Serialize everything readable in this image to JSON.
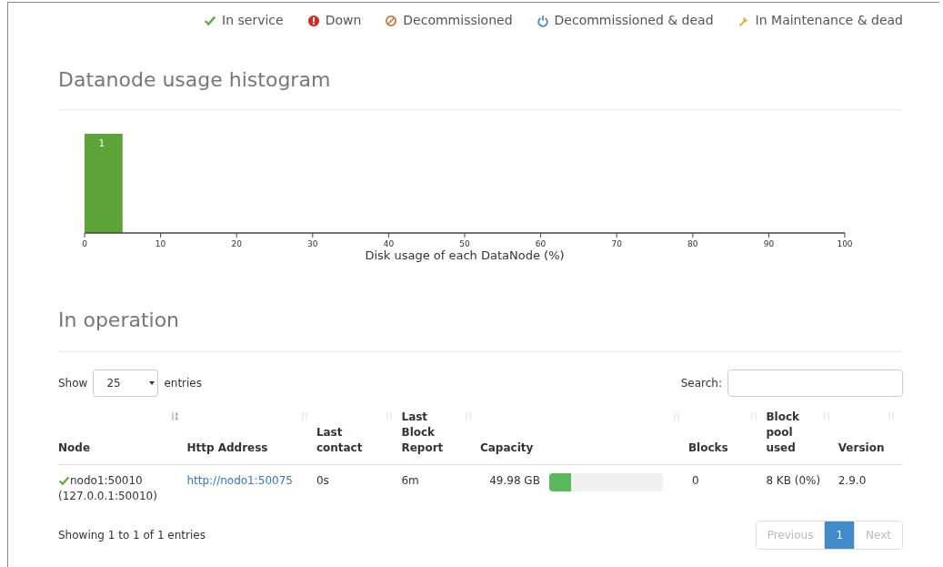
{
  "legend": [
    {
      "kind": "check",
      "label": "In service",
      "color": "#5fa83a"
    },
    {
      "kind": "down",
      "label": "Down",
      "color": "#c9302c"
    },
    {
      "kind": "decommissioned",
      "label": "Decommissioned",
      "color": "#c0783a"
    },
    {
      "kind": "power",
      "label": "Decommissioned & dead",
      "color": "#4a86c0"
    },
    {
      "kind": "wrench",
      "label": "In Maintenance & dead",
      "color": "#e8a03c"
    }
  ],
  "histogram": {
    "title": "Datanode usage histogram",
    "chart_data": {
      "type": "bar",
      "xlabel": "Disk usage of each DataNode (%)",
      "x": [
        2.5
      ],
      "values": [
        1
      ],
      "xlim": [
        0,
        100
      ],
      "xticks": [
        0,
        10,
        20,
        30,
        40,
        50,
        60,
        70,
        80,
        90,
        100
      ],
      "data_labels": true
    }
  },
  "operation": {
    "title": "In operation",
    "show_label": "Show",
    "page_size": "25",
    "entries_label": "entries",
    "search_label": "Search:",
    "columns": [
      {
        "label": "Node",
        "sorted": true
      },
      {
        "label": "Http Address",
        "sorted": false
      },
      {
        "label": "Last contact",
        "sorted": false
      },
      {
        "label": "Last Block Report",
        "sorted": false
      },
      {
        "label": "Capacity",
        "sorted": false
      },
      {
        "label": "Blocks",
        "sorted": false
      },
      {
        "label": "Block pool used",
        "sorted": false
      },
      {
        "label": "Version",
        "sorted": false
      }
    ],
    "rows": [
      {
        "kind": "check",
        "node": "nodo1:50010",
        "node_ip": "(127.0.0.1:50010)",
        "http": "http://nodo1:50075",
        "last_contact": "0s",
        "last_block_report": "6m",
        "capacity": "49.98 GB",
        "level": 0.19,
        "blocks": "0",
        "block_pool_used": "8 KB (0%)",
        "version": "2.9.0"
      }
    ],
    "info": "Showing 1 to 1 of 1 entries",
    "pagination": [
      {
        "label": "Previous",
        "selected": false,
        "disabled": true
      },
      {
        "label": "1",
        "selected": true,
        "disabled": false
      },
      {
        "label": "Next",
        "selected": false,
        "disabled": true
      }
    ]
  }
}
